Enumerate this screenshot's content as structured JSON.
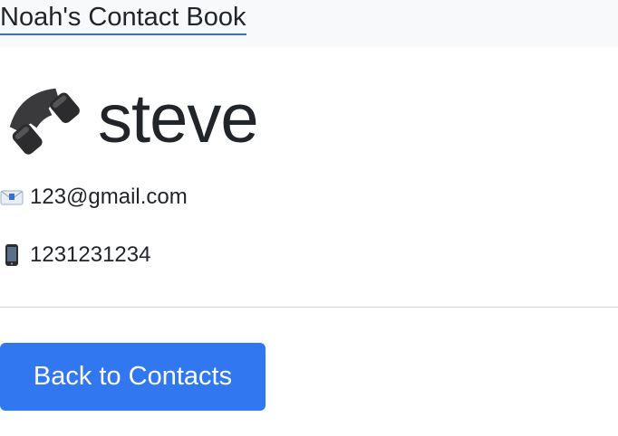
{
  "navbar": {
    "brand": "Noah's Contact Book"
  },
  "contact": {
    "name_icon": "telephone-receiver-icon",
    "name": "steve",
    "email_icon": "envelope-icon",
    "email": "123@gmail.com",
    "mobile_icon": "mobile-phone-icon",
    "phone": "1231231234"
  },
  "actions": {
    "back_label": "Back to Contacts"
  },
  "colors": {
    "navbar_bg": "#f8f9fa",
    "primary_button": "#3178f0",
    "link_underline": "#2f6fe0",
    "text": "#212529"
  }
}
